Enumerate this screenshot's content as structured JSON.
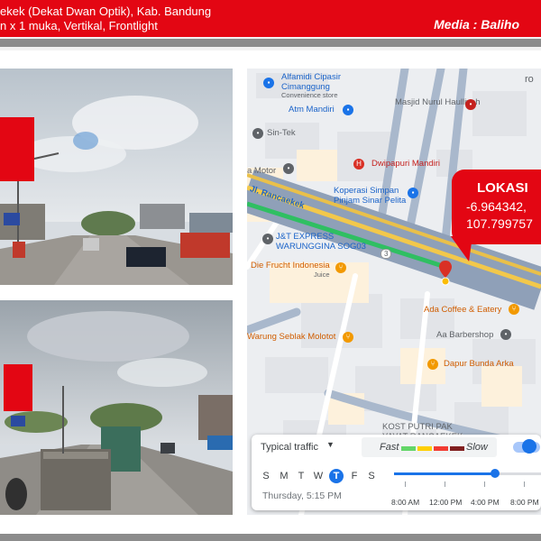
{
  "header": {
    "line1": "ekek (Dekat Dwan Optik), Kab. Bandung",
    "line2": "n x 1 muka, Vertikal, Frontlight",
    "media": "Media : Baliho"
  },
  "colors": {
    "brand_red": "#e30613",
    "band_gray": "#8c8c8c",
    "map_blue": "#1a73e8"
  },
  "map": {
    "labels": {
      "alfamidi": "Alfamidi Cipasir",
      "alfamidi2": "Cimanggung",
      "alfamidi_type": "Convenience store",
      "masjid": "Masjid Nurul Haulliyah",
      "atm": "Atm Mandiri",
      "sintek": "Sin-Tek",
      "dwipapuri": "Dwipapuri Mandiri",
      "motor": "a Motor",
      "koperasi1": "Koperasi Simpan",
      "koperasi2": "Pinjam Sinar Pelita",
      "road": "Jl. Rancaekek",
      "jnt1": "J&T EXPRESS",
      "jnt2": "WARUNGGINA SOG03",
      "route": "3",
      "diefrucht": "Die Frucht Indonesia",
      "juice": "Juice",
      "adacoffee": "Ada Coffee & Eatery",
      "warung": "Warung Seblak Molotot",
      "barber": "Aa Barbershop",
      "dapur": "Dapur Bunda Arka",
      "kost1": "KOST PUTRI PAK",
      "kost2": "YAYAT RANCAEKEK",
      "top_right": "ro"
    },
    "icons": [
      "bag-icon",
      "building-icon",
      "place-icon",
      "hospital-icon",
      "restaurant-icon",
      "location-pin-icon"
    ]
  },
  "location": {
    "title": "LOKASI",
    "lat": "-6.964342,",
    "lng": "107.799757"
  },
  "traffic": {
    "title": "Typical traffic",
    "fast": "Fast",
    "slow": "Slow",
    "days": [
      "S",
      "M",
      "T",
      "W",
      "T",
      "F",
      "S"
    ],
    "selected_day_index": 4,
    "day_time": "Thursday, 5:15 PM",
    "ticks": [
      "8:00 AM",
      "12:00 PM",
      "4:00 PM",
      "8:00 PM"
    ],
    "slider_fraction": 0.69,
    "legend_colors": [
      "#63d668",
      "#ffcf00",
      "#f23c32",
      "#811f1f"
    ]
  }
}
